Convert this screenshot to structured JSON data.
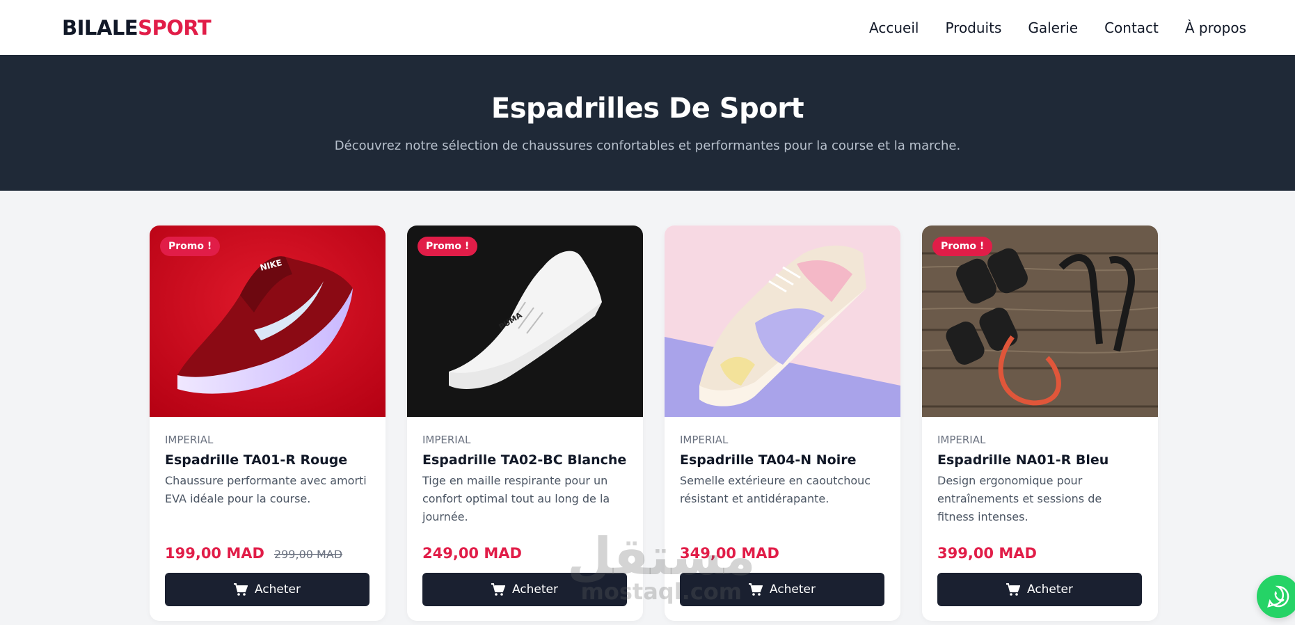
{
  "brand": {
    "part1": "BILALE",
    "part2": "SPORT"
  },
  "nav": {
    "items": [
      {
        "label": "Accueil"
      },
      {
        "label": "Produits"
      },
      {
        "label": "Galerie"
      },
      {
        "label": "Contact"
      },
      {
        "label": "À propos"
      }
    ]
  },
  "hero": {
    "title": "Espadrilles De Sport",
    "subtitle": "Découvrez notre sélection de chaussures confortables et performantes pour la course et la marche."
  },
  "products": [
    {
      "badge": "Promo !",
      "image_icon": "red-running-shoe-photo",
      "brand": "IMPERIAL",
      "name": "Espadrille TA01-R Rouge",
      "description": "Chaussure performante avec amorti EVA idéale pour la course.",
      "price": "199,00 MAD",
      "old_price": "299,00 MAD",
      "button_label": "Acheter"
    },
    {
      "badge": "Promo !",
      "image_icon": "white-sneaker-photo",
      "brand": "IMPERIAL",
      "name": "Espadrille TA02-BC Blanche",
      "description": "Tige en maille respirante pour un confort optimal tout au long de la journée.",
      "price": "249,00 MAD",
      "button_label": "Acheter"
    },
    {
      "image_icon": "pastel-sneaker-photo",
      "brand": "IMPERIAL",
      "name": "Espadrille TA04-N Noire",
      "description": "Semelle extérieure en caoutchouc résistant et antidérapante.",
      "price": "349,00 MAD",
      "button_label": "Acheter"
    },
    {
      "badge": "Promo !",
      "image_icon": "dumbbells-resistance-band-photo",
      "brand": "IMPERIAL",
      "name": "Espadrille NA01-R Bleu",
      "description": "Design ergonomique pour entraînements et sessions de fitness intenses.",
      "price": "399,00 MAD",
      "button_label": "Acheter"
    }
  ],
  "watermark": {
    "arabic": "مستقل",
    "latin": "mostaql.com"
  },
  "floating": {
    "icon": "whatsapp-icon"
  },
  "colors": {
    "accent": "#e11d48",
    "hero_bg": "#1f2937",
    "button_bg": "#1a2030",
    "whatsapp": "#25d366"
  }
}
